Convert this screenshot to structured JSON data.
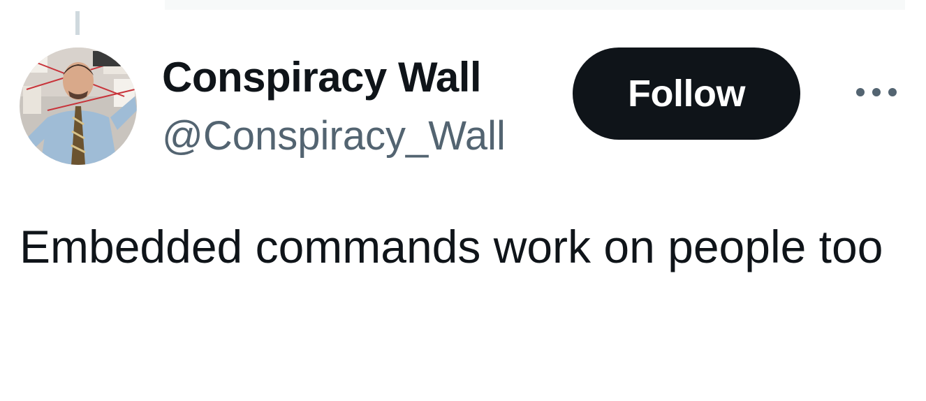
{
  "tweet": {
    "author": {
      "display_name": "Conspiracy Wall",
      "handle": "@Conspiracy_Wall",
      "avatar_icon": "profile-photo"
    },
    "follow_label": "Follow",
    "more_icon": "more-horizontal-icon",
    "text": "Embedded commands work on people too"
  },
  "colors": {
    "text_primary": "#0f1419",
    "text_secondary": "#536471",
    "button_bg": "#0f1419",
    "button_text": "#ffffff",
    "thread_line": "#cfd9de"
  }
}
